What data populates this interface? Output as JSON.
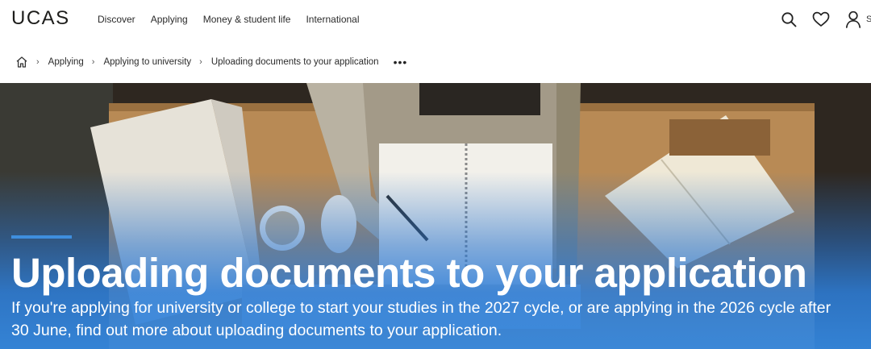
{
  "header": {
    "logo": "UCAS",
    "nav": [
      {
        "label": "Discover"
      },
      {
        "label": "Applying"
      },
      {
        "label": "Money & student life"
      },
      {
        "label": "International"
      }
    ],
    "icons": [
      "search-icon",
      "heart-icon",
      "user-icon"
    ],
    "account_label_cut": "S"
  },
  "breadcrumb": {
    "home_icon": "home-icon",
    "items": [
      {
        "label": "Applying"
      },
      {
        "label": "Applying to university"
      }
    ],
    "current": "Uploading documents to your application",
    "more": "•••"
  },
  "hero": {
    "title": "Uploading documents to your application",
    "subtitle": "If you're applying for university or college to start your studies in the 2027 cycle, or are applying in the 2026 cycle after 30 June, find out more about uploading documents to your application.",
    "accent_color": "#3e8ede",
    "overlay_color": "#3487de"
  }
}
